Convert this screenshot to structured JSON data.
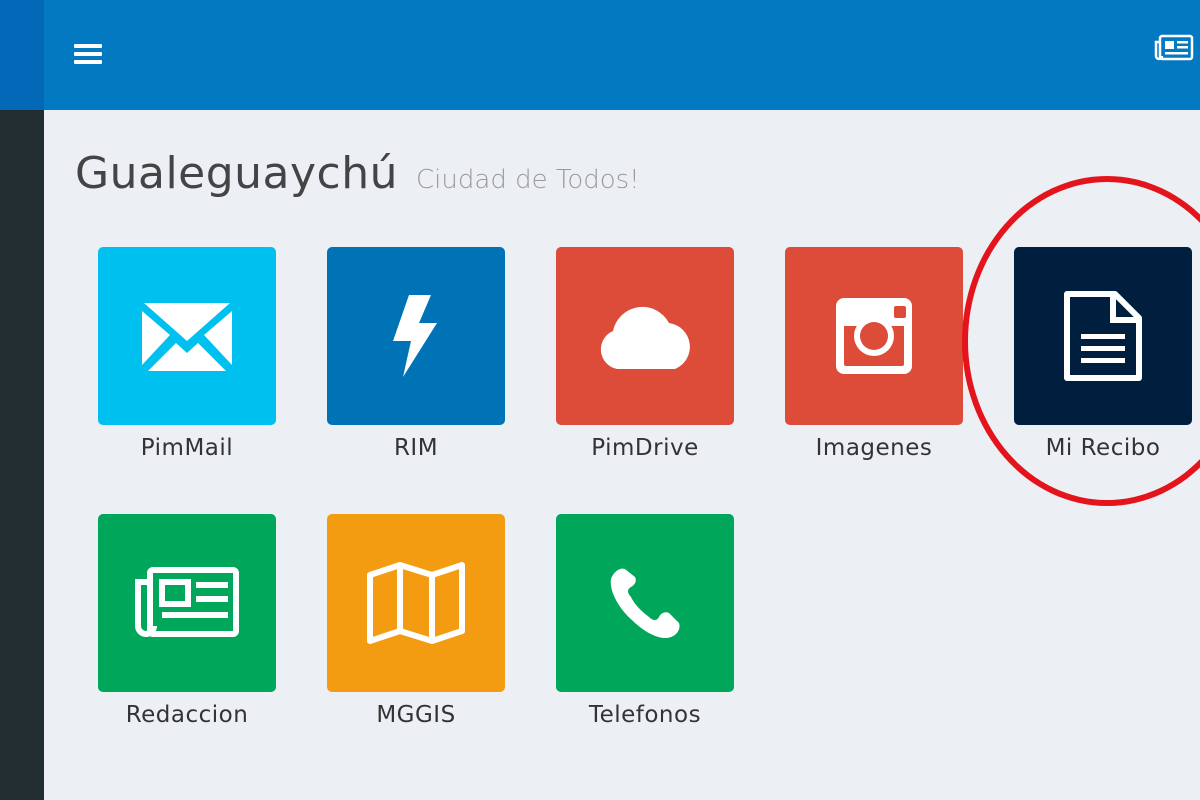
{
  "header": {
    "menu_icon": "hamburger-icon",
    "news_icon": "newspaper-icon"
  },
  "page": {
    "title": "Gualeguaychú",
    "subtitle": "Ciudad de Todos!"
  },
  "apps": [
    {
      "label": "PimMail",
      "icon": "envelope-icon",
      "color": "#00c0ef"
    },
    {
      "label": "RIM",
      "icon": "bolt-icon",
      "color": "#0073b7"
    },
    {
      "label": "PimDrive",
      "icon": "cloud-icon",
      "color": "#dd4b39"
    },
    {
      "label": "Imagenes",
      "icon": "instagram-icon",
      "color": "#dd4b39"
    },
    {
      "label": "Mi Recibo",
      "icon": "file-text-icon",
      "color": "#001f3f"
    },
    {
      "label": "Redaccion",
      "icon": "newspaper-icon",
      "color": "#00a65a"
    },
    {
      "label": "MGGIS",
      "icon": "map-icon",
      "color": "#f39c12"
    },
    {
      "label": "Telefonos",
      "icon": "phone-icon",
      "color": "#00a65a"
    }
  ],
  "highlight_color": "#e4141c"
}
